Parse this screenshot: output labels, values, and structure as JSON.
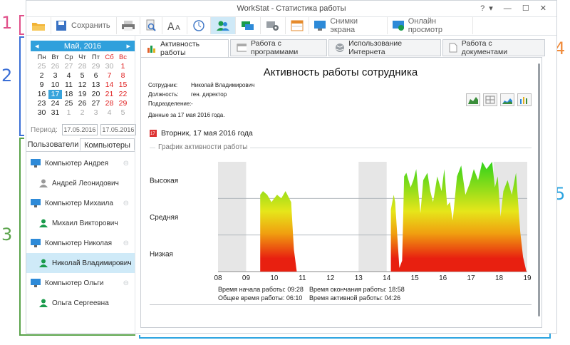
{
  "callouts": [
    "1",
    "2",
    "3",
    "4",
    "5"
  ],
  "window": {
    "title": "WorkStat - Статистика работы",
    "controls": "?▾ — ☐ ✕"
  },
  "toolbar": {
    "save_label": "Сохранить",
    "screenshots_label": "Снимки экрана",
    "online_label": "Онлайн просмотр"
  },
  "calendar": {
    "month": "Май, 2016",
    "prev": "◂",
    "next": "▸",
    "weekdays": [
      "Пн",
      "Вт",
      "Ср",
      "Чт",
      "Пт",
      "Сб",
      "Вс"
    ],
    "days": [
      [
        "25",
        "26",
        "27",
        "28",
        "29",
        "30",
        "1"
      ],
      [
        "2",
        "3",
        "4",
        "5",
        "6",
        "7",
        "8"
      ],
      [
        "9",
        "10",
        "11",
        "12",
        "13",
        "14",
        "15"
      ],
      [
        "16",
        "17",
        "18",
        "19",
        "20",
        "21",
        "22"
      ],
      [
        "23",
        "24",
        "25",
        "26",
        "27",
        "28",
        "29"
      ],
      [
        "30",
        "31",
        "1",
        "2",
        "3",
        "4",
        "5"
      ]
    ],
    "period_label": "Период:",
    "period_from": "17.05.2016",
    "period_to": "17.05.2016"
  },
  "left_tabs": {
    "users": "Пользователи",
    "computers": "Компьютеры"
  },
  "tree": [
    {
      "type": "pc",
      "label": "Компьютер Андрея"
    },
    {
      "type": "user",
      "label": "Андрей Леонидович",
      "status": "offline"
    },
    {
      "type": "pc",
      "label": "Компьютер Михаила"
    },
    {
      "type": "user",
      "label": "Михаил Викторович",
      "status": "online"
    },
    {
      "type": "pc",
      "label": "Компьютер Николая"
    },
    {
      "type": "user",
      "label": "Николай Владимирович",
      "status": "online",
      "selected": true
    },
    {
      "type": "pc",
      "label": "Компьютер Ольги"
    },
    {
      "type": "user",
      "label": "Ольга Сергеевна",
      "status": "online"
    }
  ],
  "tabs": [
    {
      "label": "Активность работы",
      "active": true
    },
    {
      "label": "Работа с программами"
    },
    {
      "label": "Использование Интернета"
    },
    {
      "label": "Работа с документами"
    }
  ],
  "report": {
    "title": "Активность работы сотрудника",
    "employee_label": "Сотрудник:",
    "employee_value": "Николай Владимирович",
    "position_label": "Должность:",
    "position_value": "ген. директор",
    "division_label": "Подразделение:",
    "division_value": "-",
    "data_date": "Данные за 17 мая 2016 года.",
    "date_header": "Вторник,  17 мая 2016 года",
    "group_label": "График активности работы",
    "start_label": "Время начала работы:",
    "start_value": "09:28",
    "total_label": "Общее время работы:",
    "total_value": "06:10",
    "end_label": "Время окончания работы:",
    "end_value": "18:58",
    "active_label": "Время активной работы:",
    "active_value": "04:26"
  },
  "chart_data": {
    "type": "area",
    "x_ticks": [
      "08",
      "09",
      "10",
      "11",
      "12",
      "13",
      "14",
      "15",
      "16",
      "17",
      "18",
      "19"
    ],
    "y_categories": [
      "Низкая",
      "Средняя",
      "Высокая"
    ],
    "xlim": [
      8,
      19
    ],
    "ylim": [
      0,
      3
    ],
    "shaded_ranges": [
      [
        8,
        9
      ],
      [
        13,
        14
      ],
      [
        17.8,
        19
      ]
    ],
    "colors": {
      "high": "#2fd21a",
      "mid": "#e6e61a",
      "low": "#e82010",
      "shade": "#e6e6e6"
    },
    "points": [
      [
        9.5,
        0
      ],
      [
        9.5,
        2.1
      ],
      [
        9.6,
        2.2
      ],
      [
        9.75,
        2.1
      ],
      [
        9.9,
        1.9
      ],
      [
        10.0,
        2.0
      ],
      [
        10.1,
        2.1
      ],
      [
        10.25,
        2.0
      ],
      [
        10.4,
        2.2
      ],
      [
        10.6,
        1.9
      ],
      [
        10.7,
        0.6
      ],
      [
        10.8,
        0
      ],
      [
        14.15,
        0
      ],
      [
        14.15,
        1.7
      ],
      [
        14.25,
        2.1
      ],
      [
        14.3,
        1.9
      ],
      [
        14.45,
        0.1
      ],
      [
        14.55,
        0.3
      ],
      [
        14.62,
        2.6
      ],
      [
        14.7,
        2.7
      ],
      [
        14.85,
        2.3
      ],
      [
        14.95,
        2.5
      ],
      [
        15.05,
        2.8
      ],
      [
        15.2,
        1.6
      ],
      [
        15.3,
        2.5
      ],
      [
        15.45,
        2.7
      ],
      [
        15.55,
        2.2
      ],
      [
        15.65,
        1.9
      ],
      [
        15.8,
        2.6
      ],
      [
        15.95,
        2.2
      ],
      [
        16.05,
        2.8
      ],
      [
        16.15,
        1.8
      ],
      [
        16.25,
        1.9
      ],
      [
        16.35,
        1.4
      ],
      [
        16.5,
        2.6
      ],
      [
        16.65,
        2.9
      ],
      [
        16.8,
        2.1
      ],
      [
        16.95,
        2.4
      ],
      [
        17.1,
        2.8
      ],
      [
        17.25,
        2.5
      ],
      [
        17.4,
        3.0
      ],
      [
        17.55,
        2.8
      ],
      [
        17.75,
        3.0
      ],
      [
        17.85,
        2.3
      ],
      [
        17.95,
        2.6
      ],
      [
        18.05,
        1.5
      ],
      [
        18.15,
        2.2
      ],
      [
        18.3,
        2.5
      ],
      [
        18.45,
        2.1
      ],
      [
        18.6,
        2.7
      ],
      [
        18.75,
        1.1
      ],
      [
        18.85,
        0.4
      ],
      [
        18.97,
        0
      ]
    ]
  }
}
